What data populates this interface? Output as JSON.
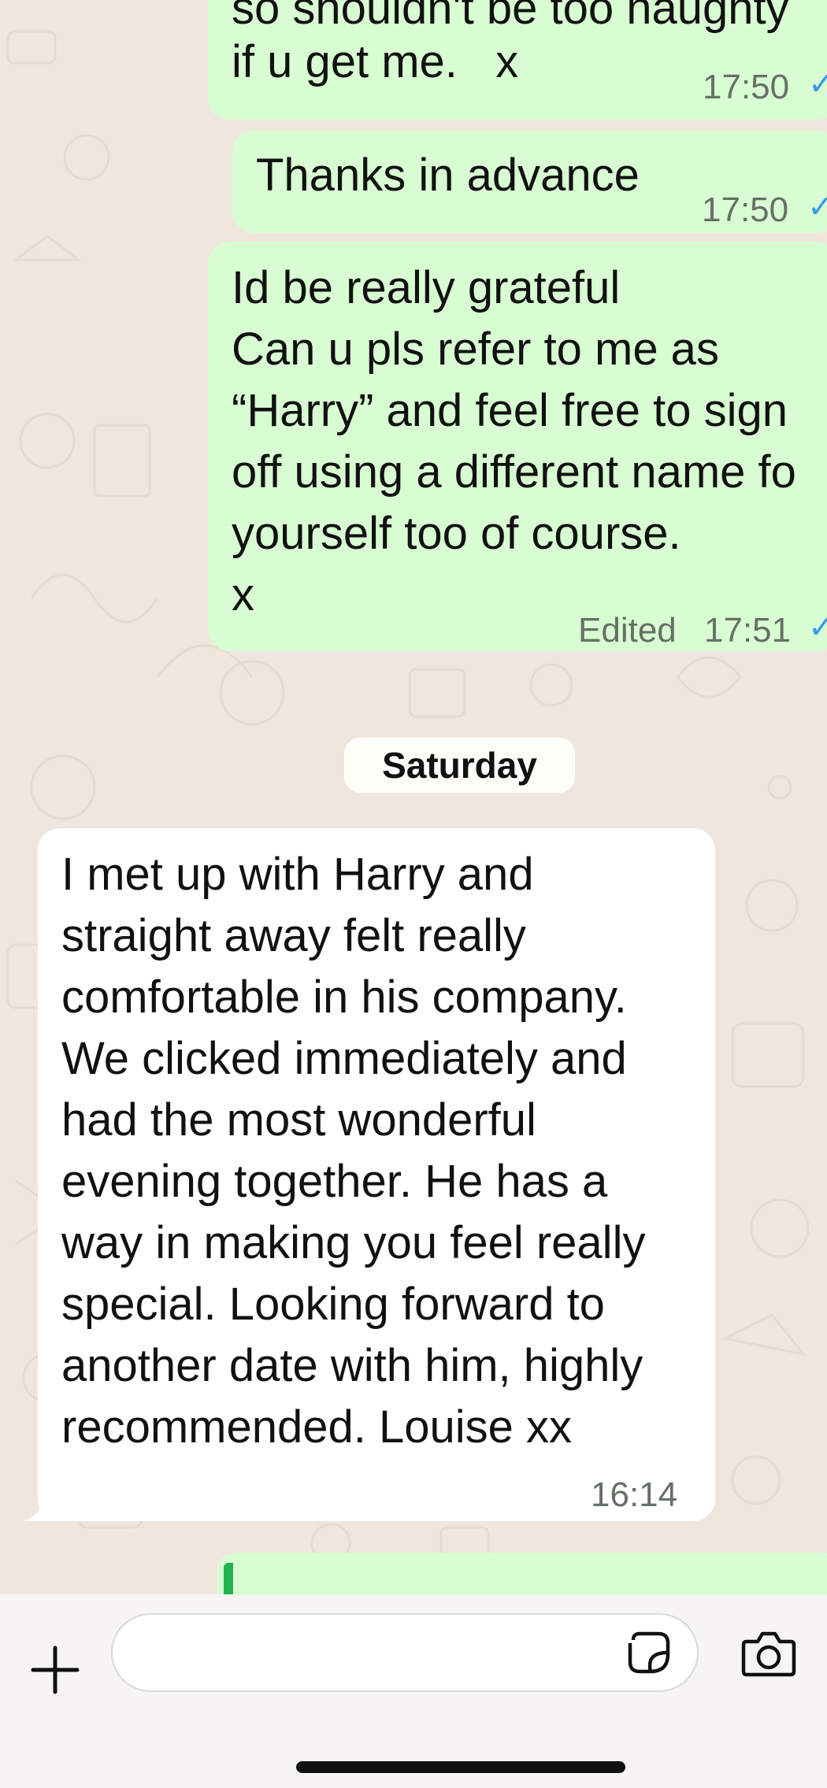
{
  "messages": [
    {
      "id": "m1",
      "direction": "outgoing",
      "top_line_partial": "so shouldn't be too naughty",
      "text": "if u get me.   x",
      "time": "17:50"
    },
    {
      "id": "m2",
      "direction": "outgoing",
      "text": "Thanks in advance",
      "time": "17:50"
    },
    {
      "id": "m3",
      "direction": "outgoing",
      "lines": [
        "Id be really grateful",
        "Can u pls refer to me as",
        "“Harry” and feel free to sign",
        "off using a different name fo",
        "yourself too of course.",
        "x"
      ],
      "edited_label": "Edited",
      "time": "17:51"
    },
    {
      "id": "m4",
      "direction": "incoming",
      "lines": [
        "I met up with Harry and",
        "straight away felt really",
        "comfortable in his company.",
        "We clicked immediately and",
        "had the most wonderful",
        "evening together. He has a",
        "way in making you feel really",
        "special. Looking forward to",
        "another date with him, highly",
        "recommended.  Louise xx"
      ],
      "time": "16:14"
    }
  ],
  "day_separator": "Saturday",
  "input": {
    "value": "",
    "placeholder": ""
  },
  "icons": {
    "plus": "plus-icon",
    "sticker": "sticker-icon",
    "camera": "camera-icon",
    "read_receipt": "read-tick-icon"
  },
  "colors": {
    "outgoing_bubble": "#d8fdd2",
    "incoming_bubble": "#ffffff",
    "chat_background": "#efe7de",
    "tick": "#3a9ae8",
    "reply_accent": "#22b24c"
  }
}
